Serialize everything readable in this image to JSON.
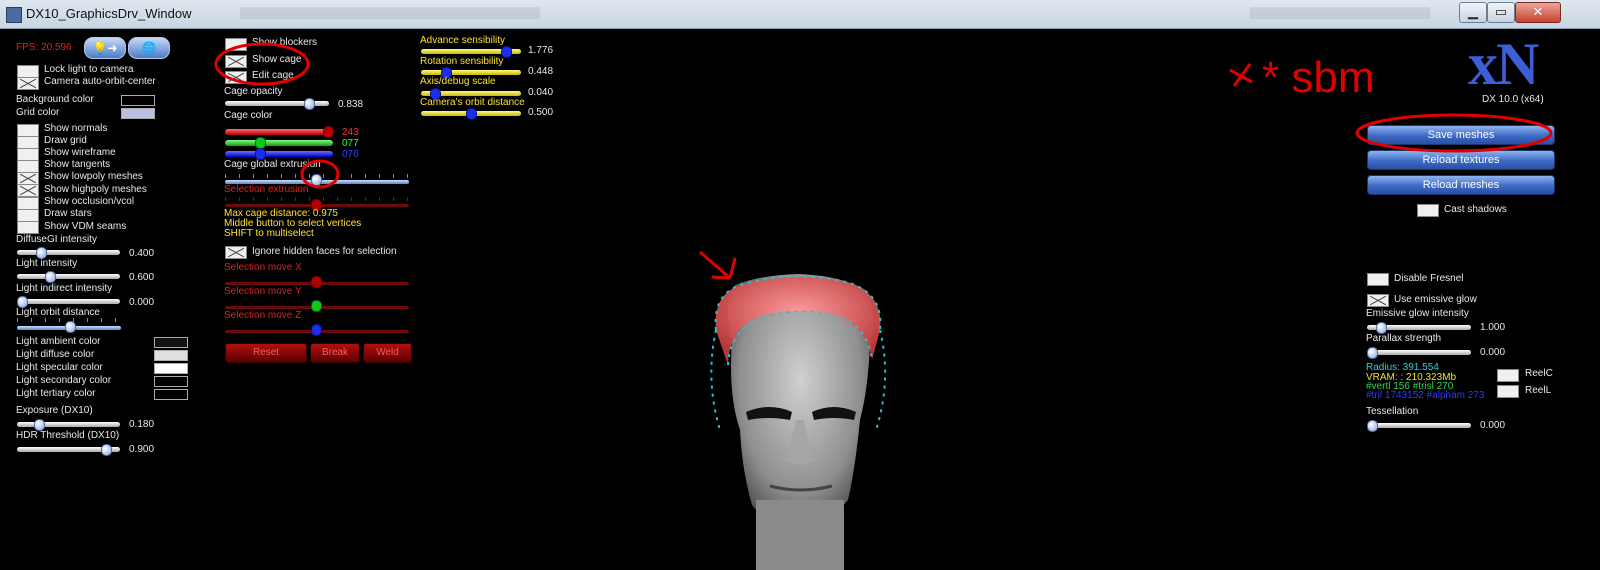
{
  "window": {
    "title": "DX10_GraphicsDrv_Window",
    "minimize": "▁",
    "maximize": "▭",
    "close": "✕"
  },
  "fps": "FPS: 20.596",
  "toolbar_icons": [
    "lightbulb-arrow-icon",
    "globe-zoom-icon"
  ],
  "left_panel": {
    "lock_light": "Lock light to camera",
    "camera_auto_orbit": "Camera auto-orbit-center",
    "background_color": "Background color",
    "grid_color": "Grid color",
    "show_normals": "Show normals",
    "draw_grid": "Draw grid",
    "show_wireframe": "Show wireframe",
    "show_tangents": "Show tangents",
    "show_lowpoly": "Show lowpoly meshes",
    "show_highpoly": "Show highpoly meshes",
    "show_occlusion": "Show occlusion/vcol",
    "draw_stars": "Draw stars",
    "show_vdm": "Show VDM seams",
    "diffusegi": {
      "label": "DiffuseGI intensity",
      "value": "0.400",
      "fraction": 0.2
    },
    "light_intensity": {
      "label": "Light intensity",
      "value": "0.600",
      "fraction": 0.3
    },
    "light_indirect": {
      "label": "Light indirect intensity",
      "value": "0.000",
      "fraction": 0.0
    },
    "light_orbit": {
      "label": "Light orbit distance"
    },
    "light_ambient": "Light ambient color",
    "light_diffuse": "Light diffuse color",
    "light_specular": "Light specular color",
    "light_secondary": "Light secondary color",
    "light_tertiary": "Light tertiary color",
    "exposure": {
      "label": "Exposure (DX10)",
      "value": "0.180",
      "fraction": 0.18
    },
    "hdr": {
      "label": "HDR Threshold (DX10)",
      "value": "0.900",
      "fraction": 0.9
    }
  },
  "cage_panel": {
    "show_blockers": "Show blockers",
    "show_cage": "Show cage",
    "edit_cage": "Edit cage",
    "cage_opacity": {
      "label": "Cage opacity",
      "value": "0.838",
      "fraction": 0.84
    },
    "cage_color": "Cage color",
    "rgb": [
      "243",
      "077",
      "076"
    ],
    "cage_global_extrusion": "Cage global extrusion",
    "selection_extrusion": "Selection extrusion",
    "max_cage_distance": "Max cage distance: 0.975",
    "middle_button": "Middle button to select vertices",
    "shift_multi": "SHIFT to multiselect",
    "ignore_hidden": "Ignore hidden faces for selection",
    "move_x": "Selection move X",
    "move_y": "Selection move Y",
    "move_z": "Selection move Z",
    "reset": "Reset",
    "break": "Break",
    "weld": "Weld"
  },
  "sensibility": {
    "advance": {
      "label": "Advance sensibility",
      "value": "1.776",
      "fraction": 0.89
    },
    "rotation": {
      "label": "Rotation sensibility",
      "value": "0.448",
      "fraction": 0.22
    },
    "axis": {
      "label": "Axis/debug scale",
      "value": "0.040",
      "fraction": 0.1
    },
    "orbit": {
      "label": "Camera's orbit distance",
      "value": "0.500",
      "fraction": 0.5
    }
  },
  "annotation_text": "* sbm",
  "right_panel": {
    "logo": "xN",
    "dx_version": "DX 10.0 (x64)",
    "save_meshes": "Save meshes",
    "reload_textures": "Reload textures",
    "reload_meshes": "Reload meshes",
    "cast_shadows": "Cast shadows",
    "disable_fresnel": "Disable Fresnel",
    "use_emissive": "Use emissive glow",
    "emissive_intensity": {
      "label": "Emissive glow intensity",
      "value": "1.000",
      "fraction": 0.1
    },
    "parallax": {
      "label": "Parallax strength",
      "value": "0.000",
      "fraction": 0.0
    },
    "radius": "Radius: 391.554",
    "vram": "VRAM: : 210.323Mb",
    "verts": "#vertl 156 #trisl 270",
    "tris": "#tril 1743152 #alpham 273",
    "reelc": "ReelC",
    "reell": "ReelL",
    "tessellation": {
      "label": "Tessellation",
      "value": "0.000",
      "fraction": 0.0
    }
  },
  "colors": {
    "accent_blue": "#3d69c5",
    "cage_red": "#e84a4a",
    "cage_vertex": "#2fc2c9",
    "annotation_red": "#e00000"
  }
}
